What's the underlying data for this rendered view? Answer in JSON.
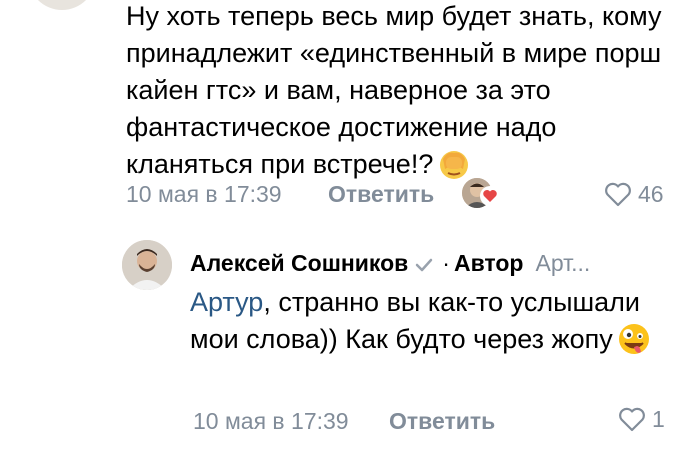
{
  "comment": {
    "text": "Ну хоть теперь весь мир будет знать, кому принадлежит «единственный в мире порш кайен гтс» и вам, наверное за это фантастическое достижение надо кланяться при встрече!?",
    "emoji": "face-palm-emoji",
    "time": "10 мая в 17:39",
    "reply_label": "Ответить",
    "likes_count": "46"
  },
  "reply": {
    "author": "Алексей Сошников",
    "separator": "·",
    "author_tag": "Автор",
    "reply_to": "Арт...",
    "mention": "Артур",
    "text": ", странно вы как-то услышали мои слова)) Как будто через жопу",
    "emoji": "zany-face-emoji",
    "time": "10 мая в 17:39",
    "reply_label": "Ответить",
    "likes_count": "1"
  },
  "colors": {
    "meta_gray": "#818c99",
    "link_blue": "#2a5885",
    "like_heart": "#e64646"
  }
}
